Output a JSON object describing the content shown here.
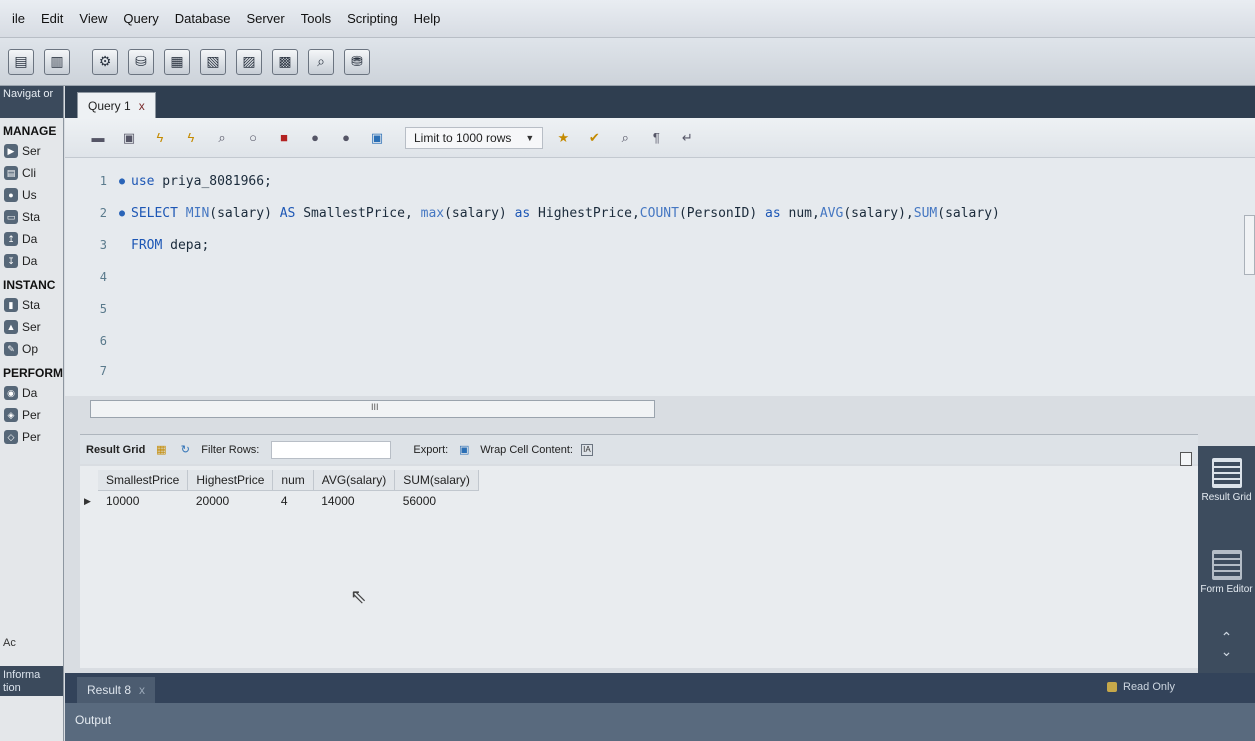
{
  "menu": [
    "ile",
    "Edit",
    "View",
    "Query",
    "Database",
    "Server",
    "Tools",
    "Scripting",
    "Help"
  ],
  "navigator": {
    "title": "Navigat or",
    "management_label": "MANAGE",
    "management_items": [
      "Ser",
      "Cli",
      "Us",
      "Sta",
      "Da",
      "Da"
    ],
    "instance_label": "INSTANC",
    "instance_items": [
      "Sta",
      "Ser",
      "Op"
    ],
    "performance_label": "PERFORM",
    "performance_items": [
      "Da",
      "Per",
      "Per"
    ],
    "footer_left": "Ac",
    "info_label": "Informa tion"
  },
  "query_tab": {
    "label": "Query 1",
    "close": "x"
  },
  "editor_toolbar": {
    "limit_label": "Limit to 1000 rows"
  },
  "editor": {
    "lines": [
      {
        "num": "1",
        "dot": "●"
      },
      {
        "num": "2",
        "dot": "●"
      },
      {
        "num": "3",
        "dot": ""
      },
      {
        "num": "4",
        "dot": ""
      },
      {
        "num": "5",
        "dot": ""
      },
      {
        "num": "6",
        "dot": ""
      },
      {
        "num": "7",
        "dot": ""
      }
    ],
    "line1": {
      "kw": "use",
      "rest": " priya_8081966;"
    },
    "line2": {
      "select": "SELECT",
      "min": "MIN",
      "p1": "(salary) ",
      "as1": "AS",
      "p2": " SmallestPrice, ",
      "max": "max",
      "p3": "(salary) ",
      "as2": "as",
      "p4": " HighestPrice,",
      "count": "COUNT",
      "p5": "(PersonID) ",
      "as3": "as",
      "p6": " num,",
      "avg": "AVG",
      "p7": "(salary),",
      "sum": "SUM",
      "p8": "(salary)"
    },
    "line3": {
      "kw": "FROM",
      "rest": " depa;"
    },
    "scroll_grip": "III"
  },
  "result_toolbar": {
    "result_grid": "Result Grid",
    "filter_rows": "Filter Rows:",
    "export": "Export:",
    "wrap": "Wrap Cell Content:",
    "wrap_icon": "IA"
  },
  "result": {
    "columns": [
      "SmallestPrice",
      "HighestPrice",
      "num",
      "AVG(salary)",
      "SUM(salary)"
    ],
    "rows": [
      [
        "10000",
        "20000",
        "4",
        "14000",
        "56000"
      ]
    ]
  },
  "side_panel": {
    "result_grid": "Result Grid",
    "form_editor": "Form Editor"
  },
  "result_tab": {
    "label": "Result 8",
    "close": "x"
  },
  "read_only": "Read Only",
  "output_label": "Output"
}
